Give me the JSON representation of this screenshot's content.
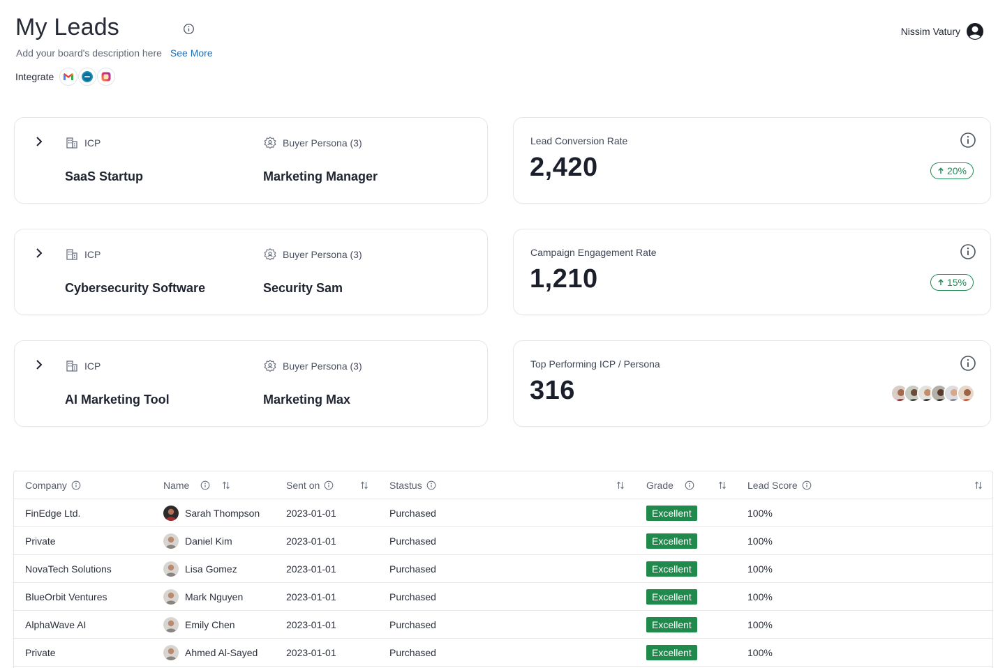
{
  "header": {
    "title": "My Leads",
    "description": "Add your board's description here",
    "see_more": "See More",
    "integrate_label": "Integrate",
    "integrations": [
      "gmail-icon",
      "hubspot-icon",
      "instagram-icon"
    ]
  },
  "user": {
    "name": "Nissim Vatury"
  },
  "icp_cards": [
    {
      "icp_label": "ICP",
      "icp_value": "SaaS Startup",
      "persona_label": "Buyer Persona (3)",
      "persona_value": "Marketing Manager"
    },
    {
      "icp_label": "ICP",
      "icp_value": "Cybersecurity Software",
      "persona_label": "Buyer Persona (3)",
      "persona_value": "Security Sam"
    },
    {
      "icp_label": "ICP",
      "icp_value": "AI Marketing Tool",
      "persona_label": "Buyer Persona (3)",
      "persona_value": "Marketing Max"
    }
  ],
  "metrics": [
    {
      "label": "Lead Conversion Rate",
      "value": "2,420",
      "trend": "20%"
    },
    {
      "label": "Campaign Engagement Rate",
      "value": "1,210",
      "trend": "15%"
    },
    {
      "label": "Top Performing ICP / Persona",
      "value": "316"
    }
  ],
  "table": {
    "columns": [
      "Company",
      "Name",
      "Sent on",
      "Stastus",
      "Grade",
      "Lead Score"
    ],
    "rows": [
      {
        "company": "FinEdge Ltd.",
        "name": "Sarah Thompson",
        "sent_on": "2023-01-01",
        "status": "Purchased",
        "grade": "Excellent",
        "score": "100%"
      },
      {
        "company": "Private",
        "name": "Daniel Kim",
        "sent_on": "2023-01-01",
        "status": "Purchased",
        "grade": "Excellent",
        "score": "100%"
      },
      {
        "company": "NovaTech Solutions",
        "name": "Lisa Gomez",
        "sent_on": "2023-01-01",
        "status": "Purchased",
        "grade": "Excellent",
        "score": "100%"
      },
      {
        "company": "BlueOrbit Ventures",
        "name": "Mark Nguyen",
        "sent_on": "2023-01-01",
        "status": "Purchased",
        "grade": "Excellent",
        "score": "100%"
      },
      {
        "company": "AlphaWave AI",
        "name": "Emily Chen",
        "sent_on": "2023-01-01",
        "status": "Purchased",
        "grade": "Excellent",
        "score": "100%"
      },
      {
        "company": "Private",
        "name": "Ahmed Al-Sayed",
        "sent_on": "2023-01-01",
        "status": "Purchased",
        "grade": "Excellent",
        "score": "100%"
      }
    ]
  },
  "colors": {
    "accent_link": "#1d6fb8",
    "trend_green": "#1e8a55",
    "grade_green": "#1f8a4c"
  }
}
